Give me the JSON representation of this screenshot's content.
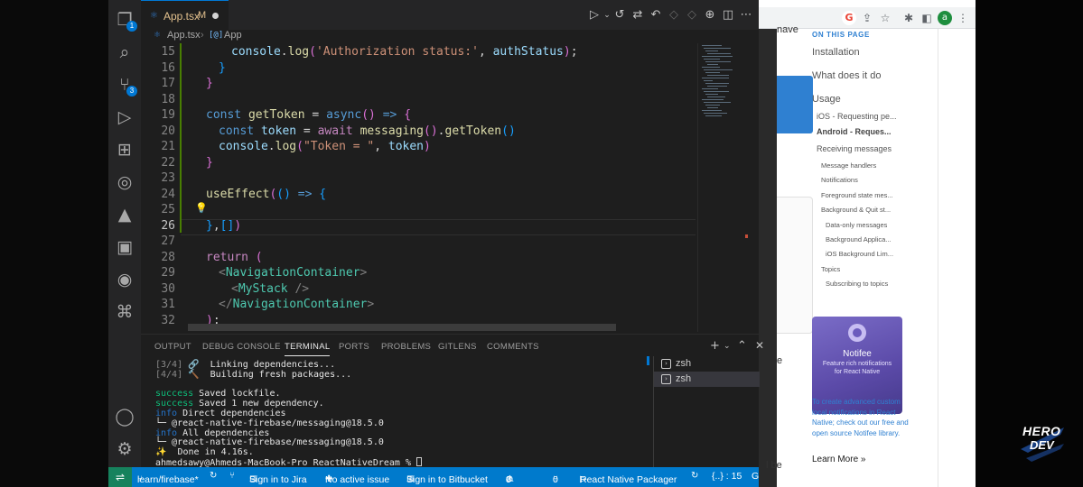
{
  "vscode": {
    "tab": {
      "icon": "typescript-file-icon",
      "filename": "App.tsx",
      "git_status": "M"
    },
    "breadcrumb": {
      "file": "App.tsx",
      "symbol": "App"
    },
    "activity_badges": {
      "explorer": "1",
      "source_control": "3"
    },
    "code_lines": [
      {
        "n": "15",
        "tokens": [
          [
            "console",
            "var"
          ],
          [
            ".",
            "d"
          ],
          [
            "log",
            "fn"
          ],
          [
            "(",
            "bracket"
          ],
          [
            "'Authorization status:'",
            "str"
          ],
          [
            ", ",
            "d"
          ],
          [
            "authStatus",
            "var"
          ],
          [
            ")",
            "bracket"
          ],
          [
            ";",
            "d"
          ]
        ],
        "indent": 2
      },
      {
        "n": "16",
        "tokens": [
          [
            "}",
            "brk2"
          ]
        ],
        "indent": 1
      },
      {
        "n": "17",
        "tokens": [
          [
            "}",
            "bracket"
          ]
        ],
        "indent": 0
      },
      {
        "n": "18",
        "tokens": [],
        "indent": 0
      },
      {
        "n": "19",
        "tokens": [
          [
            "const ",
            "kw"
          ],
          [
            "getToken",
            "fn"
          ],
          [
            " = ",
            "d"
          ],
          [
            "async",
            "kw"
          ],
          [
            "()",
            "bracket"
          ],
          [
            " => ",
            "kw"
          ],
          [
            "{",
            "bracket"
          ]
        ],
        "indent": 0
      },
      {
        "n": "20",
        "tokens": [
          [
            "const ",
            "kw"
          ],
          [
            "token",
            "var"
          ],
          [
            " = ",
            "d"
          ],
          [
            "await ",
            "ctl"
          ],
          [
            "messaging",
            "fn"
          ],
          [
            "()",
            "bracket"
          ],
          [
            ".",
            "d"
          ],
          [
            "getToken",
            "fn"
          ],
          [
            "()",
            "brk2"
          ]
        ],
        "indent": 1
      },
      {
        "n": "21",
        "tokens": [
          [
            "console",
            "var"
          ],
          [
            ".",
            "d"
          ],
          [
            "log",
            "fn"
          ],
          [
            "(",
            "bracket"
          ],
          [
            "\"Token = \"",
            "str"
          ],
          [
            ", ",
            "d"
          ],
          [
            "token",
            "var"
          ],
          [
            ")",
            "bracket"
          ]
        ],
        "indent": 1
      },
      {
        "n": "22",
        "tokens": [
          [
            "}",
            "bracket"
          ]
        ],
        "indent": 0
      },
      {
        "n": "23",
        "tokens": [],
        "indent": 0
      },
      {
        "n": "24",
        "tokens": [
          [
            "useEffect",
            "fn"
          ],
          [
            "(",
            "bracket"
          ],
          [
            "()",
            "brk2"
          ],
          [
            " => ",
            "kw"
          ],
          [
            "{",
            "brk2"
          ]
        ],
        "indent": 0
      },
      {
        "n": "25",
        "tokens": [],
        "indent": 0
      },
      {
        "n": "26",
        "tokens": [
          [
            "}",
            "brk2"
          ],
          [
            ",",
            "d"
          ],
          [
            "[",
            "brk2"
          ],
          [
            "]",
            "brk2"
          ],
          [
            ")",
            "bracket"
          ]
        ],
        "indent": 0
      },
      {
        "n": "27",
        "tokens": [],
        "indent": 0
      },
      {
        "n": "28",
        "tokens": [
          [
            "return ",
            "ctl"
          ],
          [
            "(",
            "bracket"
          ]
        ],
        "indent": 0
      },
      {
        "n": "29",
        "tokens": [
          [
            "<",
            "punc"
          ],
          [
            "NavigationContainer",
            "tag"
          ],
          [
            ">",
            "punc"
          ]
        ],
        "indent": 1
      },
      {
        "n": "30",
        "tokens": [
          [
            "<",
            "punc"
          ],
          [
            "MyStack",
            "tag"
          ],
          [
            " />",
            "punc"
          ]
        ],
        "indent": 2
      },
      {
        "n": "31",
        "tokens": [
          [
            "</",
            "punc"
          ],
          [
            "NavigationContainer",
            "tag"
          ],
          [
            ">",
            "punc"
          ]
        ],
        "indent": 1
      },
      {
        "n": "32",
        "tokens": [
          [
            ")",
            "bracket"
          ],
          [
            ";",
            "d"
          ]
        ],
        "indent": 0
      }
    ],
    "current_line": "26",
    "panel_tabs": [
      "OUTPUT",
      "DEBUG CONSOLE",
      "TERMINAL",
      "PORTS",
      "PROBLEMS",
      "GITLENS",
      "COMMENTS"
    ],
    "active_panel_tab": "TERMINAL",
    "terminal_lines": [
      [
        [
          "[3/4] ",
          "t-gray"
        ],
        [
          "🔗",
          "t-gray"
        ],
        [
          "  Linking dependencies...",
          "t-white"
        ]
      ],
      [
        [
          "[4/4] ",
          "t-gray"
        ],
        [
          "🔨",
          "t-gray"
        ],
        [
          "  Building fresh packages...",
          "t-white"
        ]
      ],
      [],
      [
        [
          "success",
          "t-green"
        ],
        [
          " Saved lockfile.",
          "t-white"
        ]
      ],
      [
        [
          "success",
          "t-green"
        ],
        [
          " Saved 1 new dependency.",
          "t-white"
        ]
      ],
      [
        [
          "info",
          "t-blue"
        ],
        [
          " Direct dependencies",
          "t-white"
        ]
      ],
      [
        [
          "└─ @react-native-firebase/messaging@18.5.0",
          "t-white"
        ]
      ],
      [
        [
          "info",
          "t-blue"
        ],
        [
          " All dependencies",
          "t-white"
        ]
      ],
      [
        [
          "└─ @react-native-firebase/messaging@18.5.0",
          "t-white"
        ]
      ],
      [
        [
          "✨  Done in 4.16s.",
          "t-white"
        ]
      ],
      [
        [
          "ahmedsawy@Ahmeds-MacBook-Pro ReactNativeDream % ",
          "t-white"
        ]
      ]
    ],
    "terminal_instances": [
      "zsh",
      "zsh"
    ],
    "statusbar": {
      "branch": "learn/firebase*",
      "jira": "Sign in to Jira",
      "issue": "No active issue",
      "bitbucket": "Sign in to Bitbucket",
      "errors": "0",
      "warnings": "0",
      "ports": "0",
      "packager": "React Native Packager",
      "braces": "{..} : 15",
      "git_edge": "G"
    }
  },
  "browser": {
    "toc_heading": "ON THIS PAGE",
    "toc": [
      {
        "label": "Installation",
        "level": 1
      },
      {
        "label": "What does it do",
        "level": 1
      },
      {
        "label": "Usage",
        "level": 1
      },
      {
        "label": "iOS - Requesting pe...",
        "level": 2
      },
      {
        "label": "Android - Reques...",
        "level": 2,
        "active": true
      },
      {
        "label": "Receiving messages",
        "level": 2
      },
      {
        "label": "Message handlers",
        "level": 3
      },
      {
        "label": "Notifications",
        "level": 3
      },
      {
        "label": "Foreground state mes...",
        "level": 3
      },
      {
        "label": "Background & Quit st...",
        "level": 3
      },
      {
        "label": "Data-only messages",
        "level": 4
      },
      {
        "label": "Background Applica...",
        "level": 4
      },
      {
        "label": "iOS Background Lim...",
        "level": 4
      },
      {
        "label": "Topics",
        "level": 3
      },
      {
        "label": "Subscribing to topics",
        "level": 4
      }
    ],
    "peek_text": {
      "have": "nave",
      "e": "e",
      "be": "l be"
    },
    "notifee": {
      "title": "Notifee",
      "subtitle": "Feature rich notifications for React Native",
      "description": "To create advanced custom local notifications in React Native; check out our free and open source Notifee library.",
      "learn_more": "Learn More »"
    },
    "profile_initial": "a"
  },
  "watermark": {
    "line1": "HERO",
    "line2": "DEV"
  }
}
